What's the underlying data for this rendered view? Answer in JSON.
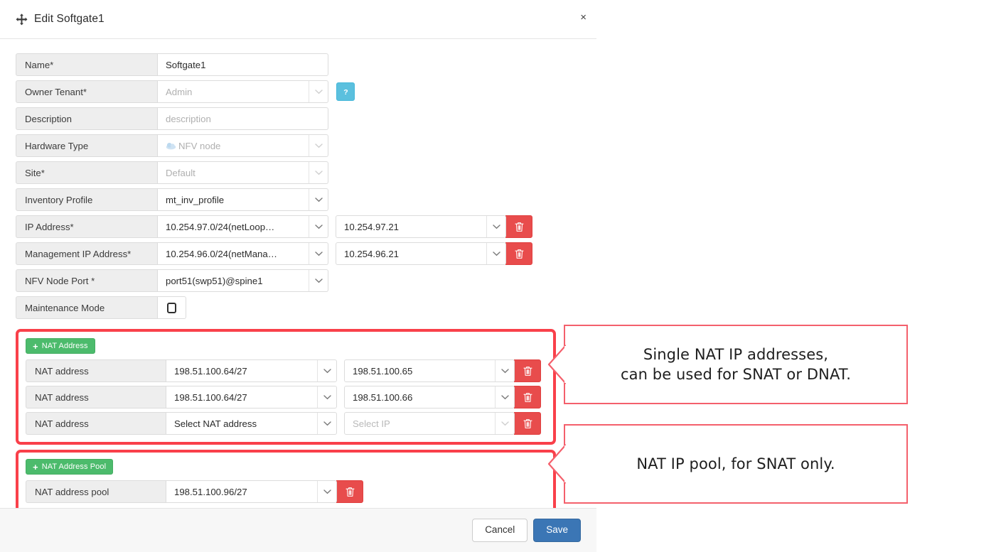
{
  "modal": {
    "title": "Edit Softgate1",
    "move_icon": "move-arrows-icon",
    "close_label": "×"
  },
  "form": {
    "rows": [
      {
        "label": "Name*",
        "value": "Softgate1",
        "type": "text",
        "disabled": false,
        "has_caret": false
      },
      {
        "label": "Owner Tenant*",
        "value": "Admin",
        "type": "select",
        "disabled": true,
        "has_caret": true,
        "help": true
      },
      {
        "label": "Description",
        "value": "description",
        "type": "text",
        "disabled": true,
        "has_caret": false
      },
      {
        "label": "Hardware Type",
        "value": "NFV node",
        "type": "select",
        "disabled": true,
        "has_caret": true,
        "icon": "cloud-icon"
      },
      {
        "label": "Site*",
        "value": "Default",
        "type": "select",
        "disabled": true,
        "has_caret": true
      },
      {
        "label": "Inventory Profile",
        "value": "mt_inv_profile",
        "type": "select",
        "disabled": false,
        "has_caret": true
      },
      {
        "label": "IP Address*",
        "value": "10.254.97.0/24(netLoop…",
        "value2": "10.254.97.21",
        "type": "select-pair",
        "disabled": false,
        "has_caret": true,
        "delete": true
      },
      {
        "label": "Management IP Address*",
        "value": "10.254.96.0/24(netMana…",
        "value2": "10.254.96.21",
        "type": "select-pair",
        "disabled": false,
        "has_caret": true,
        "delete": true
      },
      {
        "label": "NFV Node Port *",
        "value": "port51(swp51)@spine1",
        "type": "select",
        "disabled": false,
        "has_caret": true
      },
      {
        "label": "Maintenance Mode",
        "value": "",
        "type": "checkbox",
        "checked": false
      }
    ]
  },
  "nat_section": {
    "add_button": "NAT Address",
    "rows": [
      {
        "label": "NAT address",
        "network": "198.51.100.64/27",
        "ip": "198.51.100.65",
        "placeholder_network": false,
        "placeholder_ip": false
      },
      {
        "label": "NAT address",
        "network": "198.51.100.64/27",
        "ip": "198.51.100.66",
        "placeholder_network": false,
        "placeholder_ip": false
      },
      {
        "label": "NAT address",
        "network": "Select NAT address",
        "ip": "Select IP",
        "placeholder_network": false,
        "placeholder_ip": true
      }
    ]
  },
  "pool_section": {
    "add_button": "NAT Address Pool",
    "rows": [
      {
        "label": "NAT address pool",
        "network": "198.51.100.96/27"
      }
    ]
  },
  "footer": {
    "cancel_label": "Cancel",
    "save_label": "Save"
  },
  "callouts": [
    {
      "line1": "Single NAT IP addresses,",
      "line2": "can be used for SNAT or DNAT."
    },
    {
      "line1": "NAT IP pool, for SNAT only.",
      "line2": ""
    }
  ],
  "colors": {
    "highlight_red": "#f9404a",
    "callout_red": "#f4606c",
    "add_green": "#4cbb6c",
    "delete_red": "#e84c4c",
    "save_blue": "#3b76b5",
    "help_blue": "#5bc0de"
  }
}
